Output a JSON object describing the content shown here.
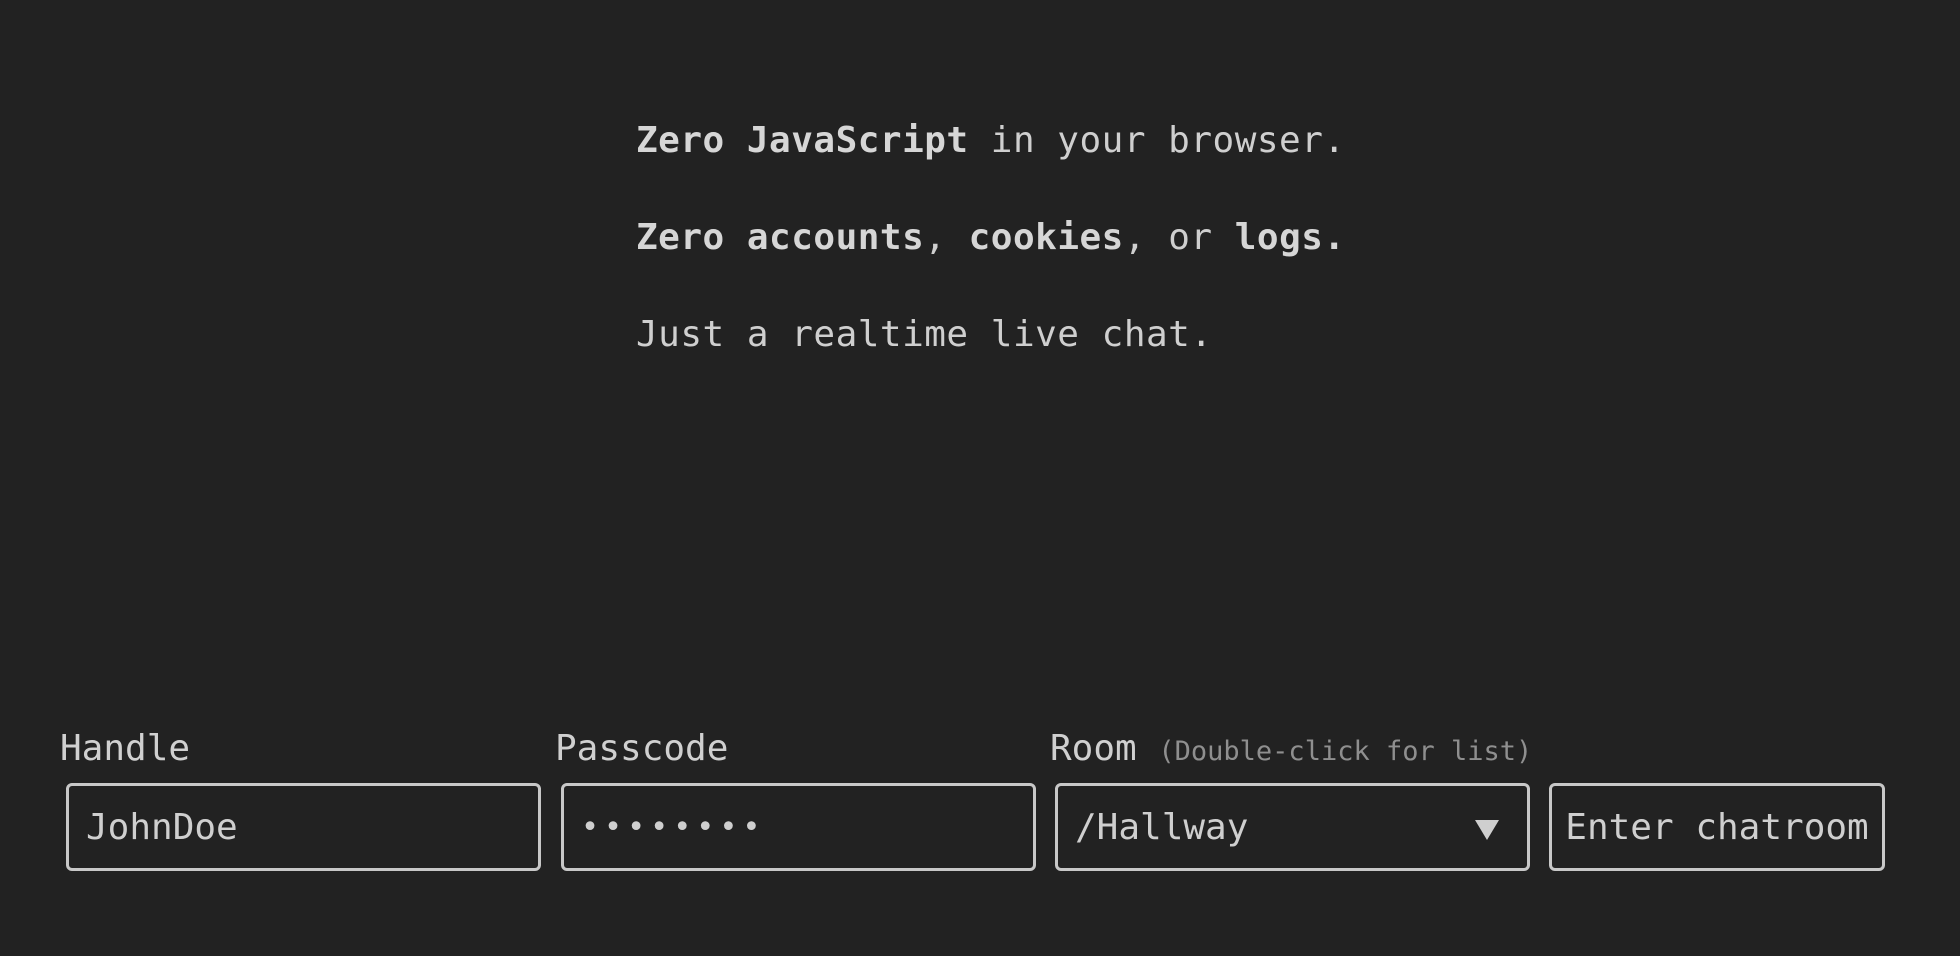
{
  "intro": {
    "line1": {
      "bold": "Zero JavaScript",
      "rest": " in your browser."
    },
    "line2": {
      "bold1": "Zero accounts",
      "sep1": ", ",
      "bold2": "cookies",
      "sep2": ", or ",
      "bold3": "logs",
      "end": "."
    },
    "line3": "Just a realtime live chat."
  },
  "form": {
    "handle": {
      "label": "Handle",
      "value": "JohnDoe"
    },
    "passcode": {
      "label": "Passcode",
      "value": "••••••••"
    },
    "room": {
      "label": "Room",
      "hint": "(Double-click for list)",
      "value": "/Hallway",
      "arrow_icon": "triangle-down"
    },
    "submit_label": "Enter chatroom"
  },
  "colors": {
    "background": "#222222",
    "text": "#cfcfcf",
    "hint": "#8f8f8f",
    "border": "#c8c8c8"
  }
}
